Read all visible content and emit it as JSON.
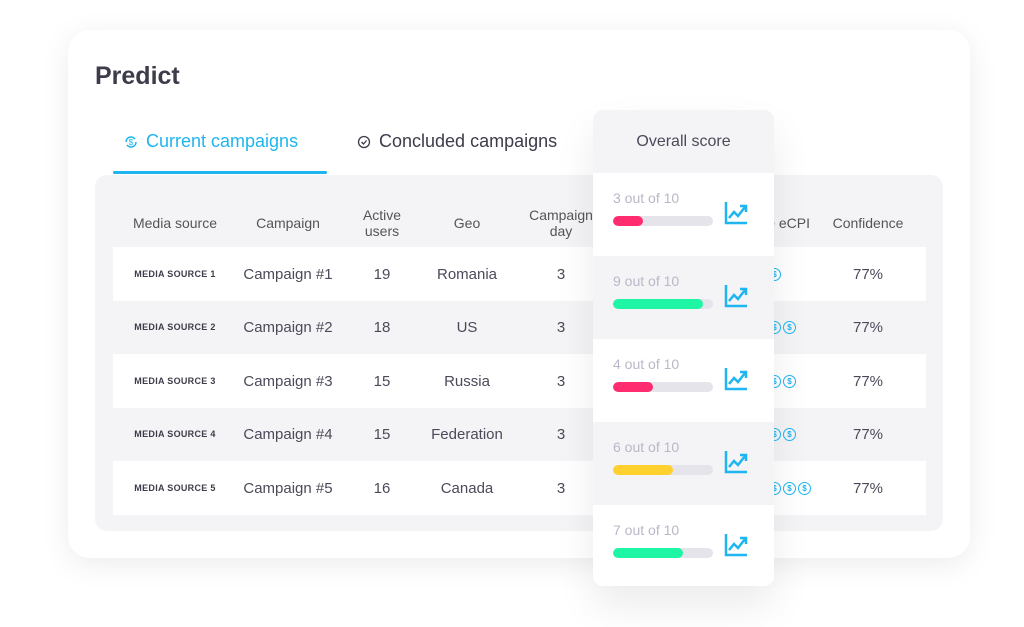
{
  "title": "Predict",
  "tabs": [
    {
      "label": "Current campaigns",
      "active": true,
      "icon": "refresh-dollar-icon"
    },
    {
      "label": "Concluded campaigns",
      "active": false,
      "icon": "check-circle-icon"
    }
  ],
  "accent": "#1fb5f0",
  "table": {
    "headers": [
      "Media source",
      "Campaign",
      "Active users",
      "Geo",
      "Campaign day",
      "e eCPI",
      "Confidence"
    ],
    "rows": [
      {
        "media_source": "MEDIA SOURCE 1",
        "campaign": "Campaign #1",
        "active_users": "19",
        "geo": "Romania",
        "day": "3",
        "coins": 1,
        "confidence": "77%"
      },
      {
        "media_source": "MEDIA SOURCE 2",
        "campaign": "Campaign #2",
        "active_users": "18",
        "geo": "US",
        "day": "3",
        "coins": 2,
        "confidence": "77%"
      },
      {
        "media_source": "MEDIA SOURCE 3",
        "campaign": "Campaign #3",
        "active_users": "15",
        "geo": "Russia",
        "day": "3",
        "coins": 2,
        "confidence": "77%"
      },
      {
        "media_source": "MEDIA SOURCE 4",
        "campaign": "Campaign #4",
        "active_users": "15",
        "geo": "Federation",
        "day": "3",
        "coins": 2,
        "confidence": "77%"
      },
      {
        "media_source": "MEDIA SOURCE 5",
        "campaign": "Campaign #5",
        "active_users": "16",
        "geo": "Canada",
        "day": "3",
        "coins": 3,
        "confidence": "77%"
      }
    ]
  },
  "overall": {
    "header": "Overall score",
    "scores": [
      {
        "label": "3 out of 10",
        "value": 3,
        "color": "#ff2d6f"
      },
      {
        "label": "9 out of 10",
        "value": 9,
        "color": "#1ef5a5"
      },
      {
        "label": "4 out of 10",
        "value": 4,
        "color": "#ff2d6f"
      },
      {
        "label": "6 out of 10",
        "value": 6,
        "color": "#ffd02e"
      },
      {
        "label": "7 out of 10",
        "value": 7,
        "color": "#1ef5a5"
      }
    ]
  }
}
